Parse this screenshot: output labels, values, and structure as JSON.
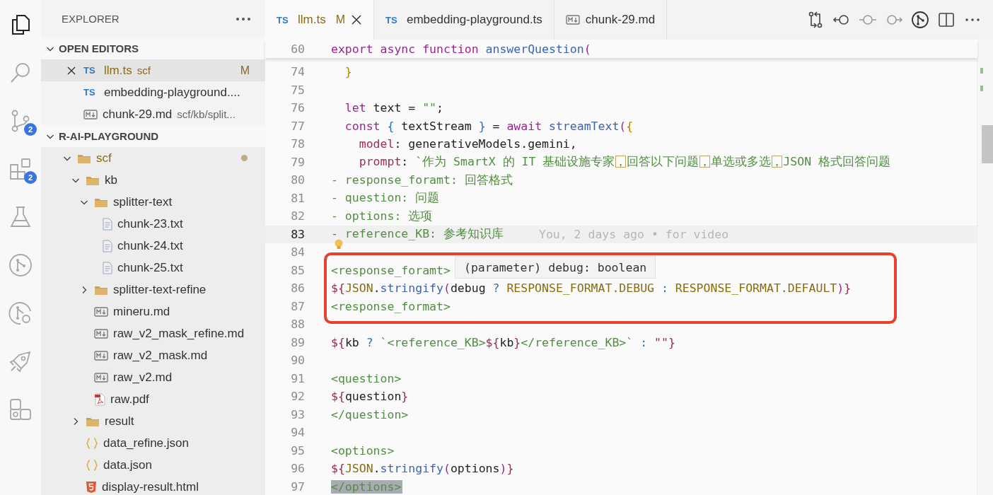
{
  "activity_bar": {
    "items": [
      {
        "kind": "files",
        "selected": true
      },
      {
        "kind": "search",
        "selected": false
      },
      {
        "kind": "source-control",
        "selected": false,
        "badge": "2"
      },
      {
        "kind": "extensions",
        "selected": false,
        "badge": "2"
      },
      {
        "kind": "testing",
        "selected": false
      },
      {
        "kind": "git-graph",
        "selected": false
      },
      {
        "kind": "git-search",
        "selected": false
      },
      {
        "kind": "rocket",
        "selected": false
      },
      {
        "kind": "remote",
        "selected": false
      }
    ]
  },
  "sidebar": {
    "title": "EXPLORER",
    "open_editors": {
      "title": "OPEN EDITORS",
      "expanded": true,
      "items": [
        {
          "name": "llm.ts",
          "kind": "ts",
          "badge": "TS",
          "description": "scf",
          "status": "M",
          "modified": true,
          "selected": true
        },
        {
          "name": "embedding-playground....",
          "kind": "ts",
          "badge": "TS",
          "modified": false,
          "selected": false
        },
        {
          "name": "chunk-29.md",
          "kind": "md",
          "description": "scf/kb/split...",
          "modified": false,
          "selected": false
        }
      ]
    },
    "workspace": {
      "title": "R-AI-PLAYGROUND",
      "expanded": true,
      "tree": [
        {
          "name": "scf",
          "kind": "folder",
          "expanded": true,
          "modified": true,
          "children": [
            {
              "name": "kb",
              "kind": "folder",
              "expanded": true,
              "children": [
                {
                  "name": "splitter-text",
                  "kind": "folder",
                  "expanded": true,
                  "children": [
                    {
                      "name": "chunk-23.txt",
                      "kind": "txt"
                    },
                    {
                      "name": "chunk-24.txt",
                      "kind": "txt"
                    },
                    {
                      "name": "chunk-25.txt",
                      "kind": "txt"
                    }
                  ]
                },
                {
                  "name": "splitter-text-refine",
                  "kind": "folder",
                  "expanded": false
                },
                {
                  "name": "mineru.md",
                  "kind": "md"
                },
                {
                  "name": "raw_v2_mask_refine.md",
                  "kind": "md"
                },
                {
                  "name": "raw_v2_mask.md",
                  "kind": "md"
                },
                {
                  "name": "raw_v2.md",
                  "kind": "md"
                },
                {
                  "name": "raw.pdf",
                  "kind": "pdf"
                }
              ]
            },
            {
              "name": "result",
              "kind": "folder",
              "expanded": false
            },
            {
              "name": "data_refine.json",
              "kind": "json"
            },
            {
              "name": "data.json",
              "kind": "json"
            },
            {
              "name": "display-result.html",
              "kind": "html"
            }
          ]
        }
      ]
    }
  },
  "tabs": [
    {
      "label": "llm.ts",
      "kind": "ts",
      "badge": "TS",
      "status": "M",
      "modified": true,
      "selected": true
    },
    {
      "label": "embedding-playground.ts",
      "kind": "ts",
      "badge": "TS",
      "modified": false,
      "selected": false
    },
    {
      "label": "chunk-29.md",
      "kind": "md",
      "modified": false,
      "selected": false
    }
  ],
  "editor": {
    "sticky_line": {
      "number": "60",
      "tokens": [
        {
          "text": "export async function ",
          "kind": "keyword"
        },
        {
          "text": "answerQuestion",
          "kind": "function"
        },
        {
          "text": "(",
          "kind": "paren"
        }
      ]
    },
    "lines": [
      {
        "number": "74",
        "current": false,
        "selected": false,
        "tokens": [
          {
            "text": "  }",
            "kind": "brace"
          }
        ]
      },
      {
        "number": "75",
        "current": false,
        "selected": false
      },
      {
        "number": "76",
        "current": false,
        "selected": false,
        "tokens": [
          {
            "text": "  let",
            "kind": "keyword"
          },
          {
            "text": " text = ",
            "kind": "variable"
          },
          {
            "text": "\"\"",
            "kind": "string"
          },
          {
            "text": ";",
            "kind": "variable"
          }
        ]
      },
      {
        "number": "77",
        "current": false,
        "selected": false,
        "tokens": [
          {
            "text": "  const ",
            "kind": "keyword"
          },
          {
            "text": "{",
            "kind": "curly"
          },
          {
            "text": " textStream ",
            "kind": "variable"
          },
          {
            "text": "}",
            "kind": "curly"
          },
          {
            "text": " = ",
            "kind": "variable"
          },
          {
            "text": "await ",
            "kind": "keyword"
          },
          {
            "text": "streamText",
            "kind": "function"
          },
          {
            "text": "(",
            "kind": "paren"
          },
          {
            "text": "{",
            "kind": "brace"
          }
        ]
      },
      {
        "number": "78",
        "current": false,
        "selected": false,
        "tokens": [
          {
            "text": "    model",
            "kind": "property"
          },
          {
            "text": ": generativeModels.gemini,",
            "kind": "variable"
          }
        ]
      },
      {
        "number": "79",
        "current": false,
        "selected": false,
        "tokens": [
          {
            "text": "    prompt",
            "kind": "property"
          },
          {
            "text": ": ",
            "kind": "variable"
          },
          {
            "text": "`作为 SmartX 的 IT 基础设施专家",
            "kind": "string"
          },
          {
            "text": "，",
            "kind": "unicode-highlight"
          },
          {
            "text": "回答以下问题",
            "kind": "string"
          },
          {
            "text": "，",
            "kind": "unicode-highlight"
          },
          {
            "text": "单选或多选",
            "kind": "string"
          },
          {
            "text": "，",
            "kind": "unicode-highlight"
          },
          {
            "text": "JSON 格式回答问题",
            "kind": "string"
          }
        ]
      },
      {
        "number": "80",
        "current": false,
        "selected": false,
        "tokens": [
          {
            "text": "- response_foramt: 回答格式",
            "kind": "string"
          }
        ]
      },
      {
        "number": "81",
        "current": false,
        "selected": false,
        "tokens": [
          {
            "text": "- question: 问题",
            "kind": "string"
          }
        ]
      },
      {
        "number": "82",
        "current": false,
        "selected": false,
        "tokens": [
          {
            "text": "- options: 选项",
            "kind": "string"
          }
        ]
      },
      {
        "number": "83",
        "current": true,
        "selected": false,
        "blame": "You, 2 days ago • for video",
        "tokens": [
          {
            "text": "- reference_KB: 参考知识库",
            "kind": "string"
          }
        ]
      },
      {
        "number": "84",
        "current": false,
        "selected": false,
        "lightbulb": true
      },
      {
        "number": "85",
        "current": false,
        "selected": false,
        "tokens": [
          {
            "text": "<response_foramt>",
            "kind": "string"
          }
        ]
      },
      {
        "number": "86",
        "current": false,
        "selected": false,
        "tokens": [
          {
            "text": "${",
            "kind": "template"
          },
          {
            "text": "JSON",
            "kind": "constant"
          },
          {
            "text": ".",
            "kind": "variable"
          },
          {
            "text": "stringify",
            "kind": "function"
          },
          {
            "text": "(",
            "kind": "paren"
          },
          {
            "text": "debug ",
            "kind": "variable"
          },
          {
            "text": "?",
            "kind": "operator"
          },
          {
            "text": " RESPONSE_FORMAT.DEBUG ",
            "kind": "constant"
          },
          {
            "text": ":",
            "kind": "operator"
          },
          {
            "text": " RESPONSE_FORMAT.DEFAULT",
            "kind": "constant"
          },
          {
            "text": ")",
            "kind": "paren"
          },
          {
            "text": "}",
            "kind": "template"
          }
        ]
      },
      {
        "number": "87",
        "current": false,
        "selected": false,
        "tokens": [
          {
            "text": "<response_format>",
            "kind": "string"
          }
        ]
      },
      {
        "number": "88",
        "current": false,
        "selected": false
      },
      {
        "number": "89",
        "current": false,
        "selected": false,
        "tokens": [
          {
            "text": "${",
            "kind": "template"
          },
          {
            "text": "kb ",
            "kind": "variable"
          },
          {
            "text": "?",
            "kind": "operator"
          },
          {
            "text": " `<reference_KB>",
            "kind": "string"
          },
          {
            "text": "${",
            "kind": "template"
          },
          {
            "text": "kb",
            "kind": "variable"
          },
          {
            "text": "}",
            "kind": "template"
          },
          {
            "text": "</reference_KB>`",
            "kind": "string"
          },
          {
            "text": " :",
            "kind": "operator"
          },
          {
            "text": " \"\"",
            "kind": "template"
          },
          {
            "text": "}",
            "kind": "template"
          }
        ]
      },
      {
        "number": "90",
        "current": false,
        "selected": false
      },
      {
        "number": "91",
        "current": false,
        "selected": false,
        "tokens": [
          {
            "text": "<question>",
            "kind": "string"
          }
        ]
      },
      {
        "number": "92",
        "current": false,
        "selected": false,
        "tokens": [
          {
            "text": "${",
            "kind": "template"
          },
          {
            "text": "question",
            "kind": "variable"
          },
          {
            "text": "}",
            "kind": "template"
          }
        ]
      },
      {
        "number": "93",
        "current": false,
        "selected": false,
        "tokens": [
          {
            "text": "</question>",
            "kind": "string"
          }
        ]
      },
      {
        "number": "94",
        "current": false,
        "selected": false
      },
      {
        "number": "95",
        "current": false,
        "selected": false,
        "tokens": [
          {
            "text": "<options>",
            "kind": "string"
          }
        ]
      },
      {
        "number": "96",
        "current": false,
        "selected": false,
        "tokens": [
          {
            "text": "${",
            "kind": "template"
          },
          {
            "text": "JSON",
            "kind": "constant"
          },
          {
            "text": ".",
            "kind": "variable"
          },
          {
            "text": "stringify",
            "kind": "function"
          },
          {
            "text": "(",
            "kind": "paren"
          },
          {
            "text": "options",
            "kind": "variable"
          },
          {
            "text": ")",
            "kind": "paren"
          },
          {
            "text": "}",
            "kind": "template"
          }
        ]
      },
      {
        "number": "97",
        "current": false,
        "selected": true,
        "tokens": [
          {
            "text": "</options>",
            "kind": "string"
          }
        ]
      }
    ],
    "hover": {
      "text": "(parameter) debug: boolean"
    }
  }
}
